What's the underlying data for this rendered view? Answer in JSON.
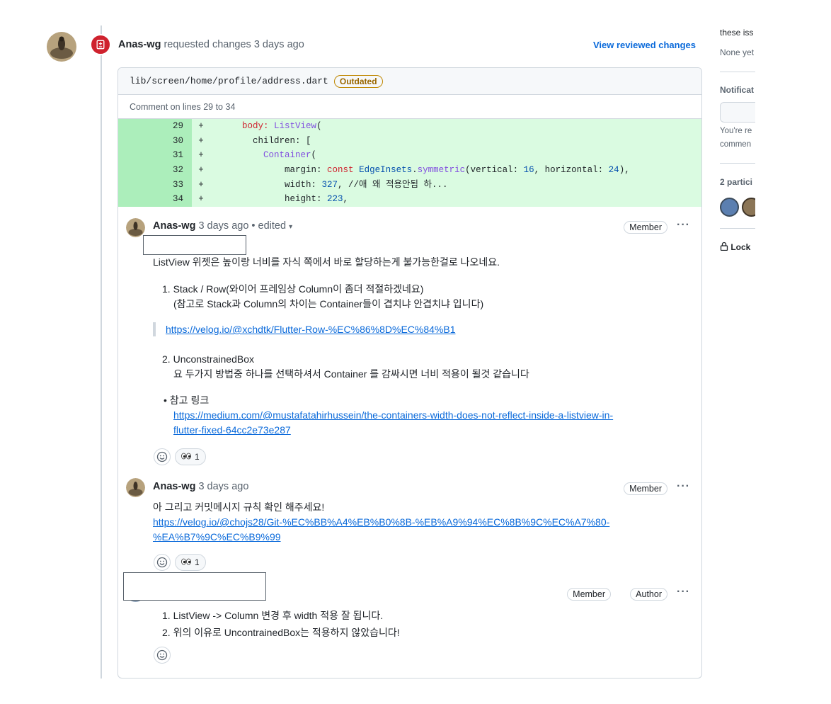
{
  "review": {
    "author": "Anas-wg",
    "action": " requested changes 3 days ago",
    "view_changes": "View reviewed changes"
  },
  "file": {
    "path": "lib/screen/home/profile/address.dart",
    "badge": "Outdated",
    "comment_range": "Comment on lines 29 to 34"
  },
  "code_lines": [
    {
      "num": "29",
      "mark": "+"
    },
    {
      "num": "30",
      "mark": "+"
    },
    {
      "num": "31",
      "mark": "+"
    },
    {
      "num": "32",
      "mark": "+"
    },
    {
      "num": "33",
      "mark": "+"
    },
    {
      "num": "34",
      "mark": "+"
    }
  ],
  "code_tokens": {
    "l29_a": "      ",
    "l29_b": "body",
    "l29_c": ": ",
    "l29_d": "ListView",
    "l29_e": "(",
    "l30_a": "        children: [",
    "l31_a": "          ",
    "l31_b": "Container",
    "l31_c": "(",
    "l32_a": "              margin: ",
    "l32_b": "const",
    "l32_c": " ",
    "l32_d": "EdgeInsets",
    "l32_e": ".",
    "l32_f": "symmetric",
    "l32_g": "(vertical: ",
    "l32_h": "16",
    "l32_i": ", horizontal: ",
    "l32_j": "24",
    "l32_k": "),",
    "l33_a": "              width: ",
    "l33_b": "327",
    "l33_c": ", //애 왜 적용안됨 하...",
    "l34_a": "              height: ",
    "l34_b": "223",
    "l34_c": ","
  },
  "comments": [
    {
      "author": "Anas-wg",
      "meta": "3 days ago",
      "edited": " • edited",
      "labels": [
        "Member"
      ],
      "kebab": "···",
      "p1": "ListView 위젯은 높이랑 너비를 자식 쪽에서 바로 할당하는게 불가능한걸로 나오네요.",
      "li1_num": "1.",
      "li1_a": "Stack / Row(와이어 프레임상 Column이 좀더 적절하겠네요)",
      "li1_b": "(참고로 Stack과 Column의 차이는 Container들이 겹치냐 안겹치냐 입니다)",
      "quote_link": "https://velog.io/@xchdtk/Flutter-Row-%EC%86%8D%EC%84%B1",
      "li2_num": "2.",
      "li2_a": "UnconstrainedBox",
      "li2_b": "요 두가지 방법중 하나를 선택하셔서 Container 를 감싸시면 너비 적용이 될것 같습니다",
      "bullet": "•",
      "bullet_text": "참고 링크",
      "ref_link_1": "https://medium.com/@mustafatahirhussein/the-containers-width-does-not-reflect-inside-a-listview-in-",
      "ref_link_2": "flutter-fixed-64cc2e73e287",
      "reaction_count": "1"
    },
    {
      "author": "Anas-wg",
      "meta": "3 days ago",
      "labels": [
        "Member"
      ],
      "kebab": "···",
      "p1": "아 그리고 커밋메시지 규칙 확인 해주세요!",
      "link_1": "https://velog.io/@chojs28/Git-%EC%BB%A4%EB%B0%8B-%EB%A9%94%EC%8B%9C%EC%A7%80-",
      "link_2": "%EA%B7%9C%EC%B9%99",
      "reaction_count": "1"
    },
    {
      "labels": [
        "Member",
        "Author"
      ],
      "kebab": "···",
      "li1_num": "1.",
      "li1": "ListView -> Column 변경 후 width 적용 잘 됩니다.",
      "li2_num": "2.",
      "li2": "위의 이유로 UncontrainedBox는 적용하지 않았습니다!"
    }
  ],
  "sidebar": {
    "issues": "these iss",
    "none_yet": "None yet",
    "notifications": "Notificat",
    "notify_1": "You're re",
    "notify_2": "commen",
    "participants": "2 partici",
    "lock": "Lock"
  },
  "colors": {
    "accent": "#0969da",
    "danger": "#cf222e",
    "added_bg": "#dafbe1",
    "added_num_bg": "#aceebb",
    "outdated": "#9a6700"
  }
}
